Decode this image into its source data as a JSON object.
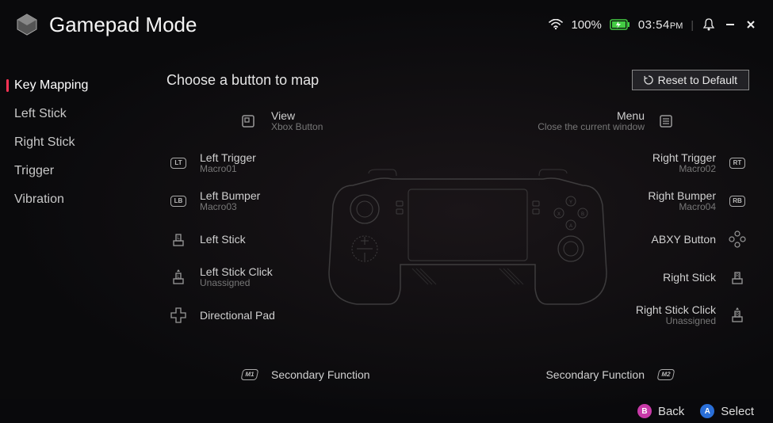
{
  "header": {
    "title": "Gamepad Mode",
    "battery_pct": "100%",
    "time": "03:54",
    "time_suffix": "PM"
  },
  "sidebar": {
    "items": [
      {
        "label": "Key Mapping",
        "active": true
      },
      {
        "label": "Left Stick",
        "active": false
      },
      {
        "label": "Right Stick",
        "active": false
      },
      {
        "label": "Trigger",
        "active": false
      },
      {
        "label": "Vibration",
        "active": false
      }
    ]
  },
  "main": {
    "title": "Choose a button to map",
    "reset_label": "Reset to Default",
    "top_left": {
      "label": "View",
      "sub": "Xbox Button",
      "icon": "view"
    },
    "top_right": {
      "label": "Menu",
      "sub": "Close the current window",
      "icon": "menu"
    },
    "left_rows": [
      {
        "label": "Left Trigger",
        "sub": "Macro01",
        "icon": "LT"
      },
      {
        "label": "Left Bumper",
        "sub": "Macro03",
        "icon": "LB"
      },
      {
        "label": "Left Stick",
        "sub": "",
        "icon": "LSTICK"
      },
      {
        "label": "Left Stick Click",
        "sub": "Unassigned",
        "icon": "LSCLICK"
      },
      {
        "label": "Directional Pad",
        "sub": "",
        "icon": "DPAD"
      }
    ],
    "right_rows": [
      {
        "label": "Right Trigger",
        "sub": "Macro02",
        "icon": "RT"
      },
      {
        "label": "Right Bumper",
        "sub": "Macro04",
        "icon": "RB"
      },
      {
        "label": "ABXY Button",
        "sub": "",
        "icon": "ABXY"
      },
      {
        "label": "Right Stick",
        "sub": "",
        "icon": "RSTICK"
      },
      {
        "label": "Right Stick Click",
        "sub": "Unassigned",
        "icon": "RSCLICK"
      }
    ],
    "bottom_left": {
      "label": "Secondary Function",
      "icon": "M1"
    },
    "bottom_right": {
      "label": "Secondary Function",
      "icon": "M2"
    }
  },
  "footer": {
    "back": "Back",
    "select": "Select"
  }
}
